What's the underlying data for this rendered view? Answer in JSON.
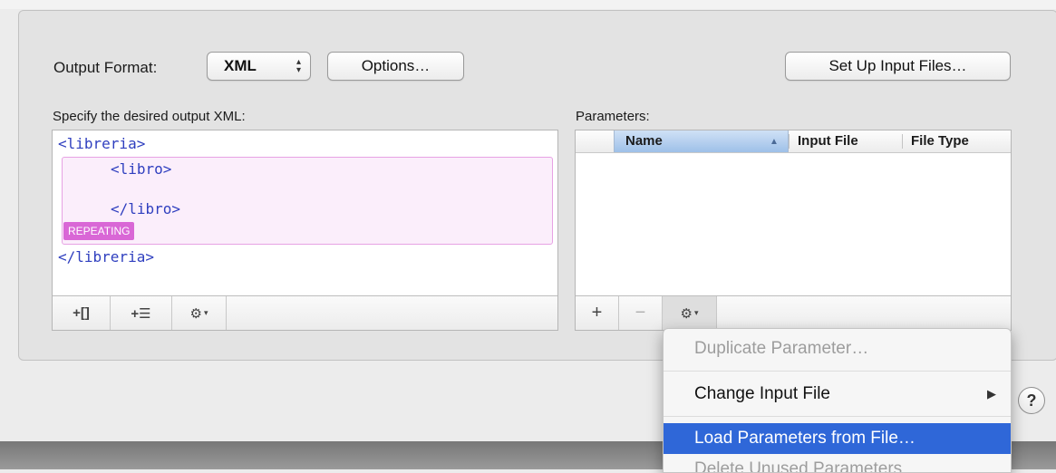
{
  "output_format": {
    "label": "Output Format:",
    "value": "XML",
    "popup_arrows": "▴▾"
  },
  "buttons": {
    "options": "Options…",
    "setup_input": "Set Up Input Files…"
  },
  "xml_editor": {
    "heading": "Specify the desired output XML:",
    "lines": [
      "<libreria>",
      "<libro>",
      "</libro>",
      "</libreria>"
    ],
    "repeating_badge": "REPEATING",
    "toolbar": {
      "add_element": "+[]",
      "add_list": "+☰",
      "gear": "⚙",
      "gear_arrow": "▾"
    }
  },
  "parameters": {
    "heading": "Parameters:",
    "columns": [
      "Name",
      "Input File",
      "File Type"
    ],
    "sort_indicator": "▲",
    "toolbar": {
      "add": "+",
      "remove": "−",
      "gear": "⚙",
      "gear_arrow": "▾"
    }
  },
  "context_menu": {
    "items": [
      {
        "label": "Duplicate Parameter…",
        "enabled": false
      },
      {
        "label": "Change Input File",
        "submenu_arrow": "▶",
        "enabled": true
      },
      {
        "label": "Load Parameters from File…",
        "highlighted": true,
        "enabled": true
      },
      {
        "label": "Delete Unused Parameters",
        "enabled": false
      }
    ]
  },
  "help": {
    "label": "?"
  },
  "colors": {
    "accent": "#2f67d8",
    "code": "#2f3fbf",
    "repeat_badge": "#d967d6"
  }
}
